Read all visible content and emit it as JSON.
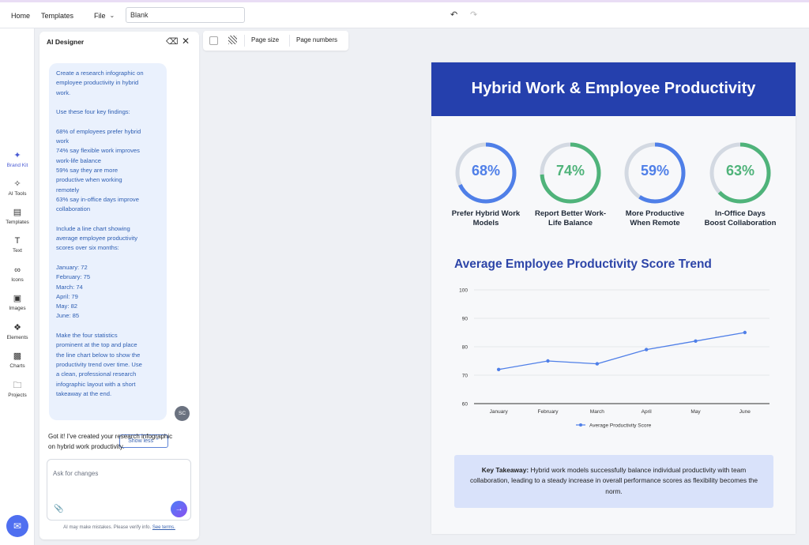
{
  "topbar": {
    "home": "Home",
    "templates": "Templates",
    "file": "File",
    "doc_name": "Blank"
  },
  "rail": {
    "items": [
      {
        "label": "Brand Kit",
        "icon": "magic-wand-icon"
      },
      {
        "label": "AI Tools",
        "icon": "sparkle-icon"
      },
      {
        "label": "Templates",
        "icon": "templates-icon"
      },
      {
        "label": "Text",
        "icon": "text-icon"
      },
      {
        "label": "Icons",
        "icon": "shapes-icon"
      },
      {
        "label": "Images",
        "icon": "image-icon"
      },
      {
        "label": "Elements",
        "icon": "elements-icon"
      },
      {
        "label": "Charts",
        "icon": "chart-icon"
      },
      {
        "label": "Projects",
        "icon": "folder-icon"
      }
    ]
  },
  "panel": {
    "title": "AI Designer",
    "prompt_lines": [
      "Create a research infographic on",
      "employee productivity in hybrid",
      "work.",
      "",
      "Use these four key findings:",
      "",
      "68% of employees prefer hybrid",
      "work",
      "74% say flexible work improves",
      "work-life balance",
      "59% say they are more",
      "productive when working",
      "remotely",
      "63% say in-office days improve",
      "collaboration",
      "",
      "Include a line chart showing",
      "average employee productivity",
      "scores over six months:",
      "",
      "January: 72",
      "February: 75",
      "March: 74",
      "April: 79",
      "May: 82",
      "June: 85",
      "",
      "Make the four statistics",
      "prominent at the top and place",
      "the line chart below to show the",
      "productivity trend over time. Use",
      "a clean, professional research",
      "infographic layout with a short",
      "takeaway at the end."
    ],
    "show_less": "Show less",
    "avatar_initials": "SC",
    "reply_line1": "Got it! I've created your research infographic",
    "reply_line2": "on hybrid work productivity.",
    "ask_placeholder": "Ask for changes",
    "disclaimer": "AI may make mistakes. Please verify info.",
    "disclaimer_link": "See terms."
  },
  "canvas_toolbar": {
    "page_size": "Page size",
    "page_numbers": "Page numbers"
  },
  "infographic": {
    "title": "Hybrid Work & Employee Productivity",
    "stats": [
      {
        "value": "68%",
        "pct": 68,
        "caption_line1": "Prefer Hybrid Work",
        "caption_line2": "Models",
        "color": "#4f7fe8"
      },
      {
        "value": "74%",
        "pct": 74,
        "caption_line1": "Report Better Work-",
        "caption_line2": "Life Balance",
        "color": "#4fb37a"
      },
      {
        "value": "59%",
        "pct": 59,
        "caption_line1": "More Productive",
        "caption_line2": "When Remote",
        "color": "#4f7fe8"
      },
      {
        "value": "63%",
        "pct": 63,
        "caption_line1": "In-Office Days",
        "caption_line2": "Boost Collaboration",
        "color": "#4fb37a"
      }
    ],
    "chart_title": "Average Employee Productivity Score Trend",
    "takeaway_label": "Key Takeaway:",
    "takeaway_text": " Hybrid work models successfully balance individual productivity with team collaboration, leading to a steady increase in overall performance scores as flexibility becomes the norm."
  },
  "chart_data": {
    "type": "line",
    "title": "Average Employee Productivity Score Trend",
    "categories": [
      "January",
      "February",
      "March",
      "April",
      "May",
      "June"
    ],
    "series": [
      {
        "name": "Average Productivity Score",
        "values": [
          72,
          75,
          74,
          79,
          82,
          85
        ],
        "color": "#4f7fe8"
      }
    ],
    "ylim": [
      60,
      100
    ],
    "yticks": [
      60,
      70,
      80,
      90,
      100
    ],
    "grid": true,
    "legend": "bottom"
  }
}
